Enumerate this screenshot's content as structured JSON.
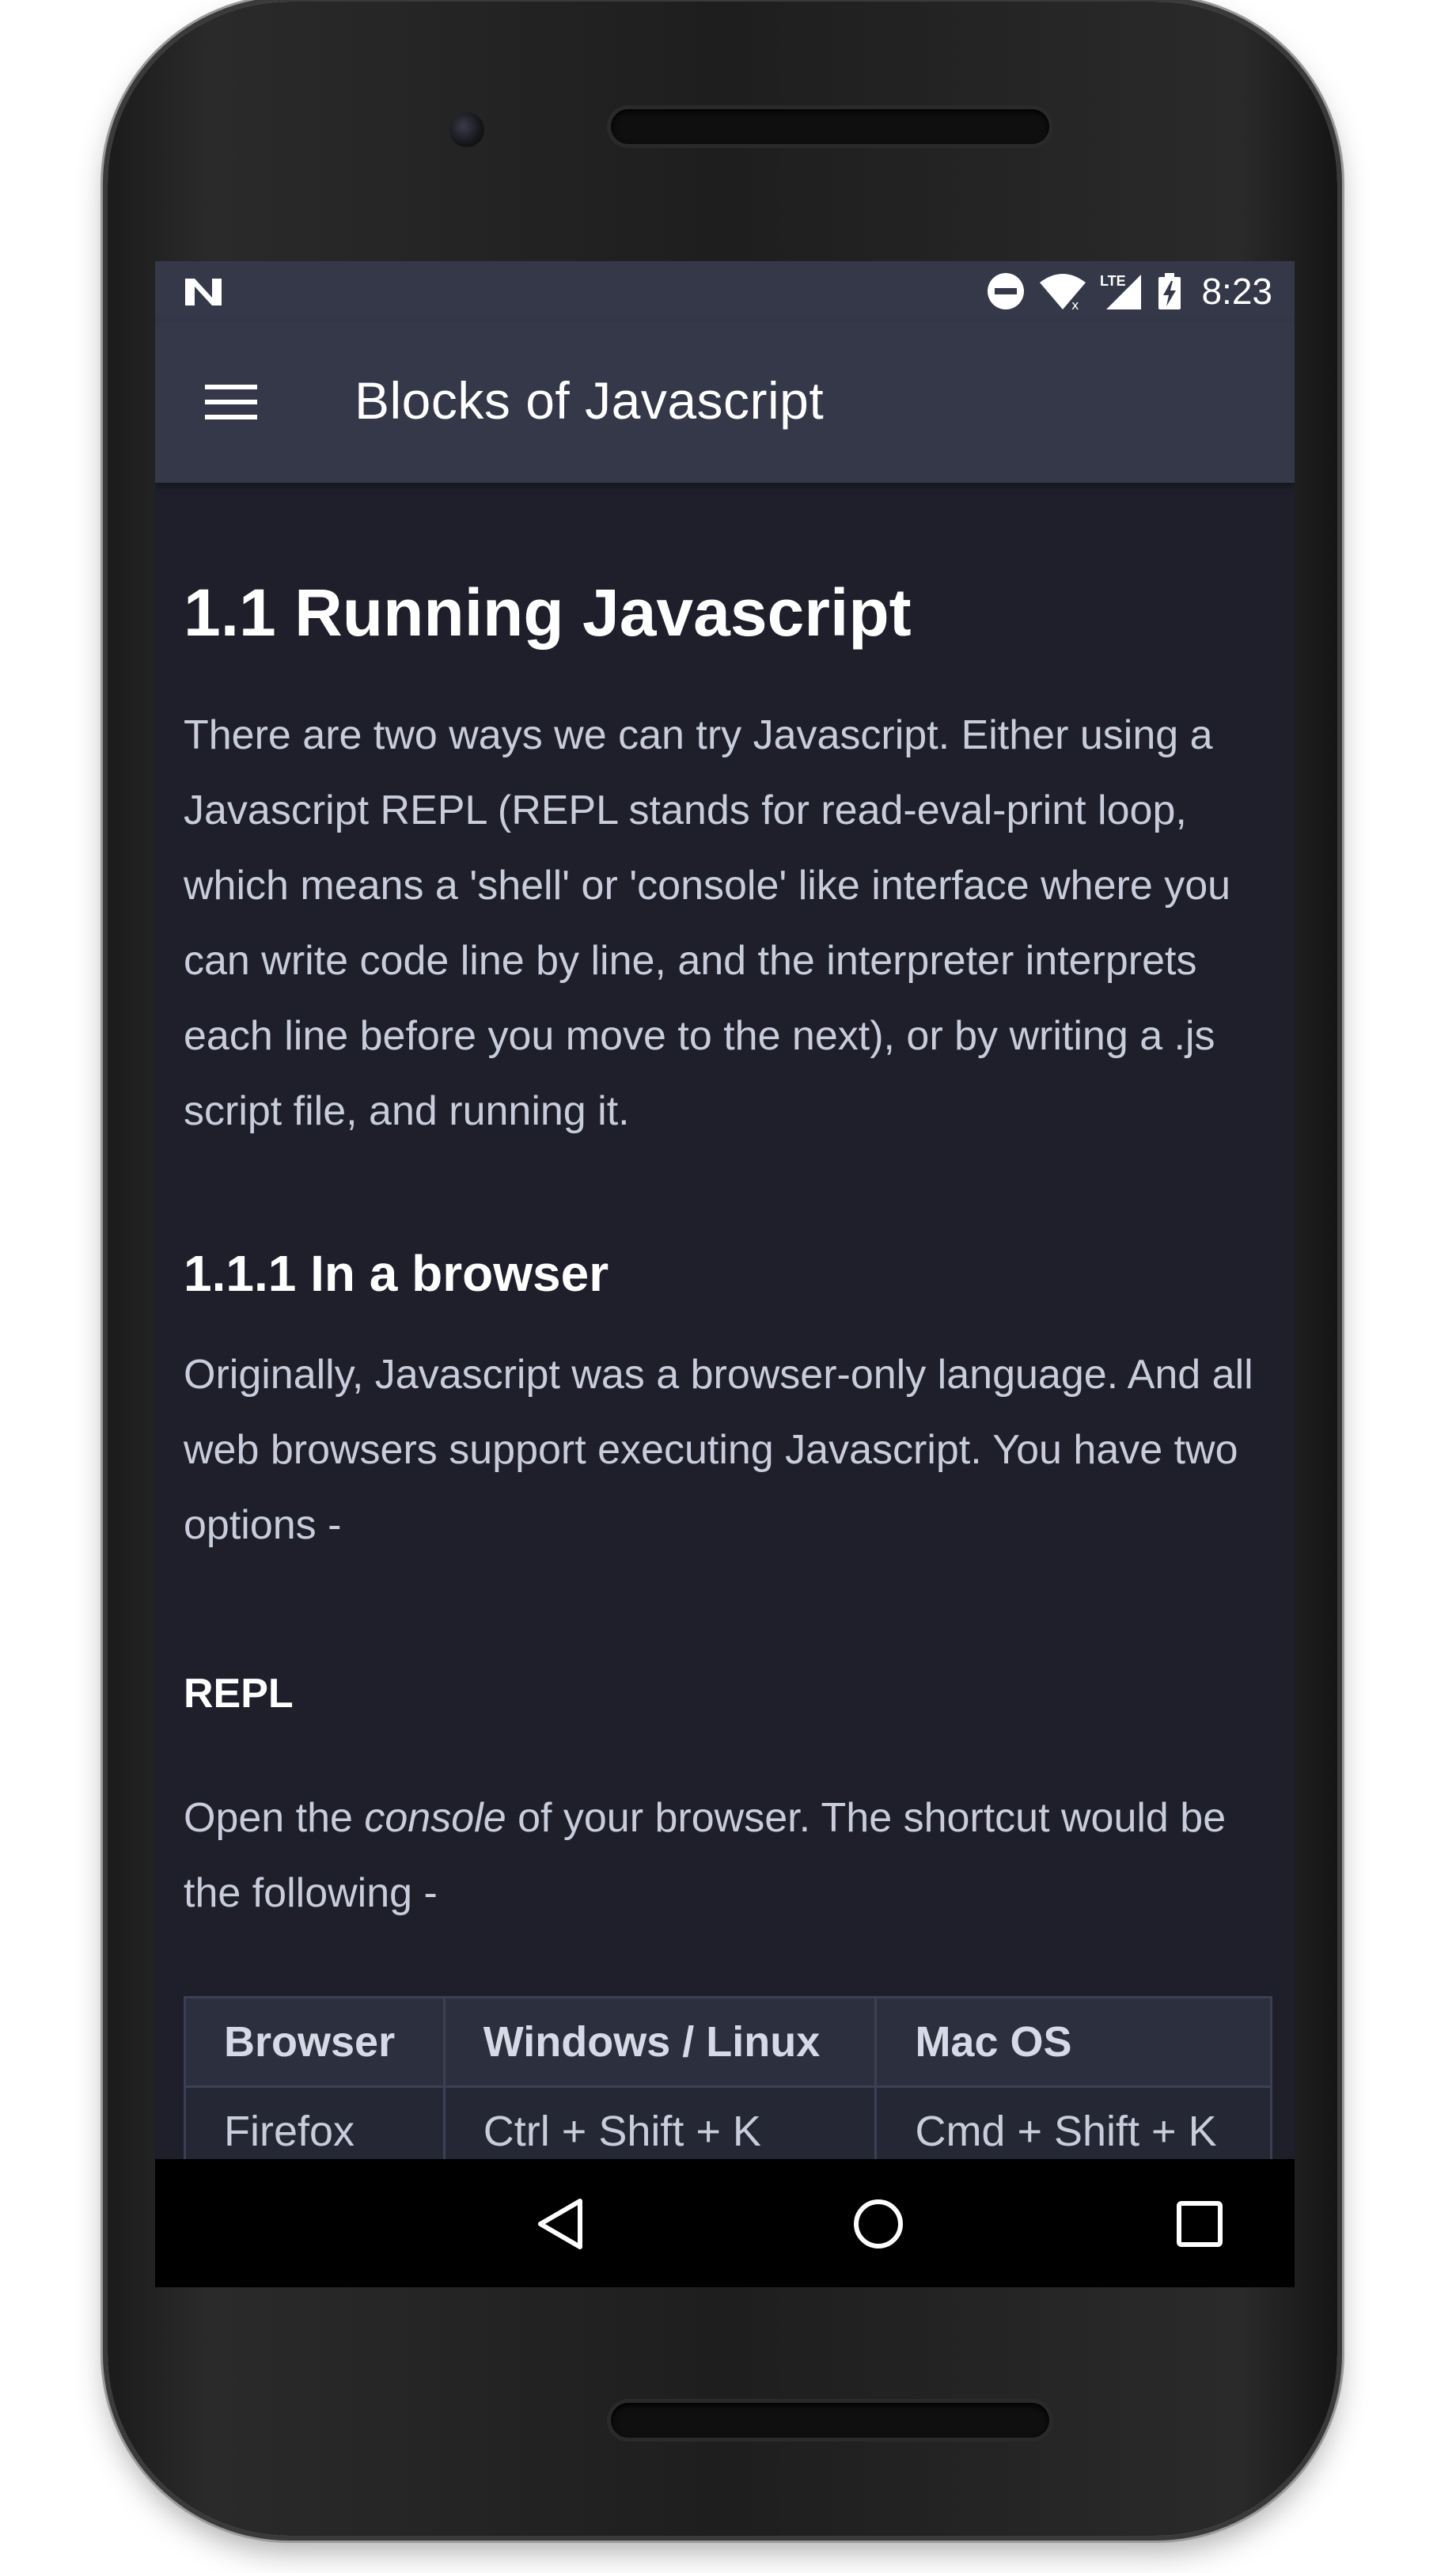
{
  "status_bar": {
    "time": "8:23",
    "network_label": "LTE",
    "icons": [
      "notification-n-icon",
      "do-not-disturb-icon",
      "wifi-icon",
      "signal-icon",
      "battery-charging-icon"
    ]
  },
  "app_bar": {
    "title": "Blocks of Javascript",
    "menu_icon": "hamburger-menu-icon"
  },
  "article": {
    "heading": "1.1 Running Javascript",
    "intro": "There are two ways we can try Javascript. Either using a Javascript REPL (REPL stands for read-eval-print loop, which means a 'shell' or 'console' like interface where you can write code line by line, and the interpreter interprets each line before you move to the next), or by writing a .js script file, and running it.",
    "subheading": "1.1.1 In a browser",
    "browser_para": "Originally, Javascript was a browser-only language. And all web browsers support executing Javascript. You have two options -",
    "repl_label": "REPL",
    "console_para_before": "Open the ",
    "console_para_emph": "console",
    "console_para_after": " of your browser. The shortcut would be the following -",
    "table": {
      "headers": [
        "Browser",
        "Windows / Linux",
        "Mac OS"
      ],
      "rows": [
        [
          "Firefox",
          "Ctrl + Shift + K",
          "Cmd + Shift + K"
        ]
      ]
    }
  },
  "nav_bar": {
    "icons": [
      "back-icon",
      "home-icon",
      "recents-icon"
    ]
  },
  "colors": {
    "app_bar": "#353848",
    "background": "#1e1f2b",
    "text": "#c9cddb",
    "heading": "#ffffff"
  }
}
